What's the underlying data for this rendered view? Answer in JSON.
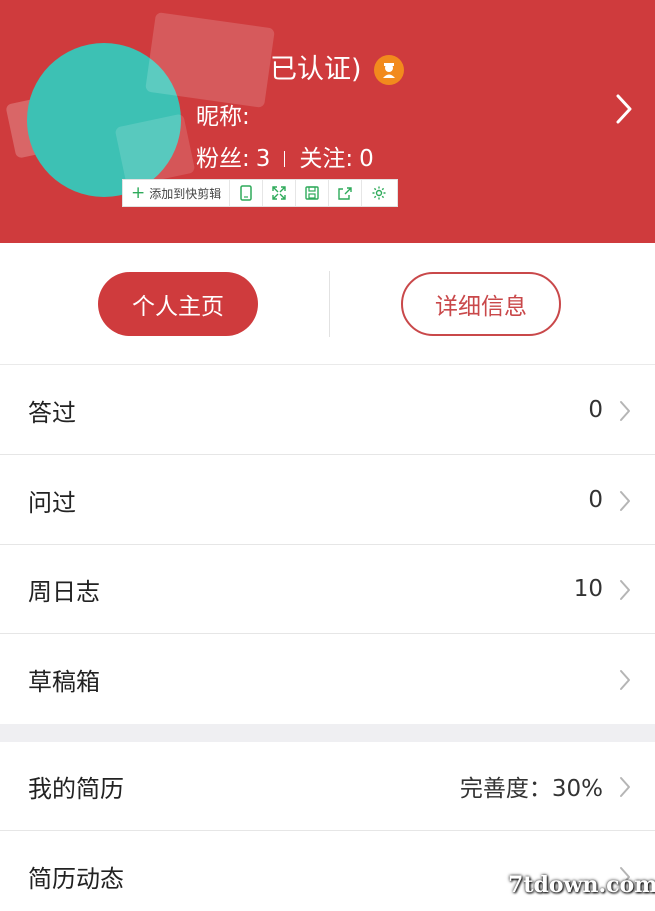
{
  "header": {
    "verified_text": "已认证)",
    "nickname_label": "昵称:",
    "fans_label": "粉丝:",
    "fans_count": "3",
    "follow_label": "关注:",
    "follow_count": "0",
    "bg_color": "#cf3b3d",
    "avatar_color": "#3dc1b4",
    "badge_color": "#f28a1d"
  },
  "clipper": {
    "add_label": "添加到快剪辑",
    "icons": [
      "tablet-icon",
      "expand-icon",
      "save-icon",
      "share-icon",
      "settings-icon"
    ]
  },
  "buttons": {
    "home_label": "个人主页",
    "detail_label": "详细信息"
  },
  "list": [
    {
      "label": "答过",
      "value": "0"
    },
    {
      "label": "问过",
      "value": "0"
    },
    {
      "label": "周日志",
      "value": "10"
    },
    {
      "label": "草稿箱",
      "value": ""
    }
  ],
  "list2": [
    {
      "label": "我的简历",
      "value": "完善度：30%"
    },
    {
      "label": "简历动态",
      "value": ""
    }
  ],
  "watermark": "7tdown.com"
}
